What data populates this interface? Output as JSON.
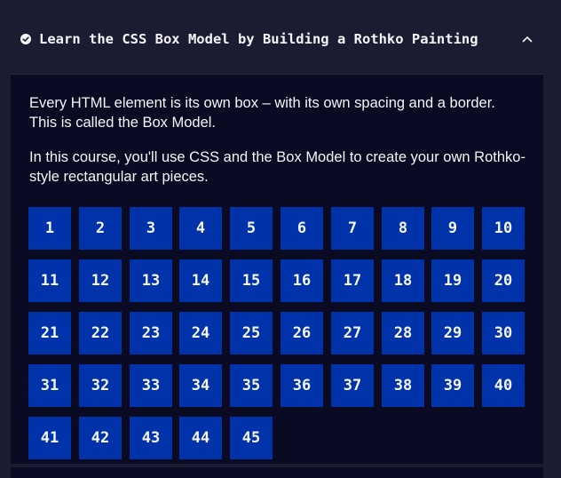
{
  "course": {
    "title": "Learn the CSS Box Model by Building a Rothko Painting",
    "completed_icon": "check-circle-icon",
    "toggle_icon": "chevron-up-icon",
    "paragraphs": [
      "Every HTML element is its own box – with its own spacing and a border. This is called the Box Model.",
      "In this course, you'll use CSS and the Box Model to create your own Rothko-style rectangular art pieces."
    ],
    "steps": [
      "1",
      "2",
      "3",
      "4",
      "5",
      "6",
      "7",
      "8",
      "9",
      "10",
      "11",
      "12",
      "13",
      "14",
      "15",
      "16",
      "17",
      "18",
      "19",
      "20",
      "21",
      "22",
      "23",
      "24",
      "25",
      "26",
      "27",
      "28",
      "29",
      "30",
      "31",
      "32",
      "33",
      "34",
      "35",
      "36",
      "37",
      "38",
      "39",
      "40",
      "41",
      "42",
      "43",
      "44",
      "45"
    ]
  },
  "colors": {
    "background": "#1b1b32",
    "panel": "#0a0a23",
    "step_box": "#0033aa",
    "text": "#f5f6f7"
  }
}
